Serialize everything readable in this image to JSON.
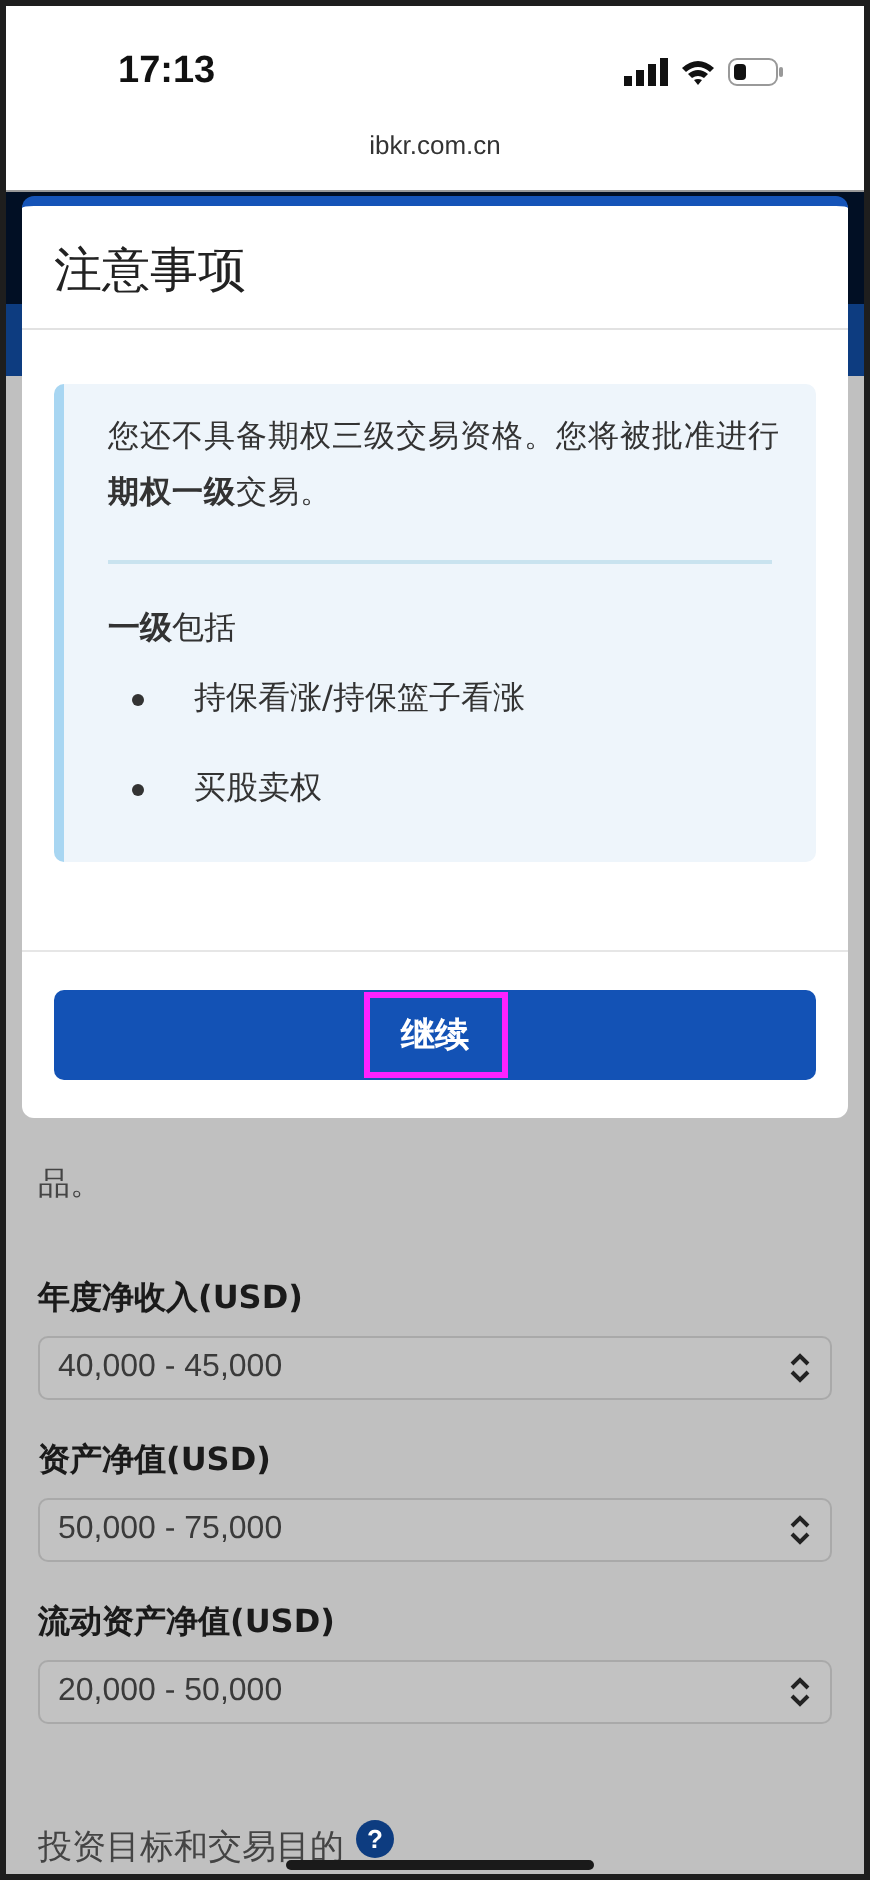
{
  "status_bar": {
    "time": "17:13",
    "url": "ibkr.com.cn"
  },
  "background": {
    "paragraph": "品。",
    "fields": [
      {
        "label": "年度净收入(USD)",
        "value": "40,000 - 45,000"
      },
      {
        "label": "资产净值(USD)",
        "value": "50,000 - 75,000"
      },
      {
        "label": "流动资产净值(USD)",
        "value": "20,000 - 50,000"
      }
    ],
    "section_heading": "投资目标和交易目的",
    "help_label": "?"
  },
  "dialog": {
    "title": "注意事项",
    "message": "您还不具备期权三级交易资格。您将被批准进行**期权一级**交易。",
    "list_title": "**一级**包括",
    "items": [
      "持保看涨/持保篮子看涨",
      "买股卖权"
    ],
    "button": {
      "label": "继续",
      "highlighted": true
    }
  }
}
